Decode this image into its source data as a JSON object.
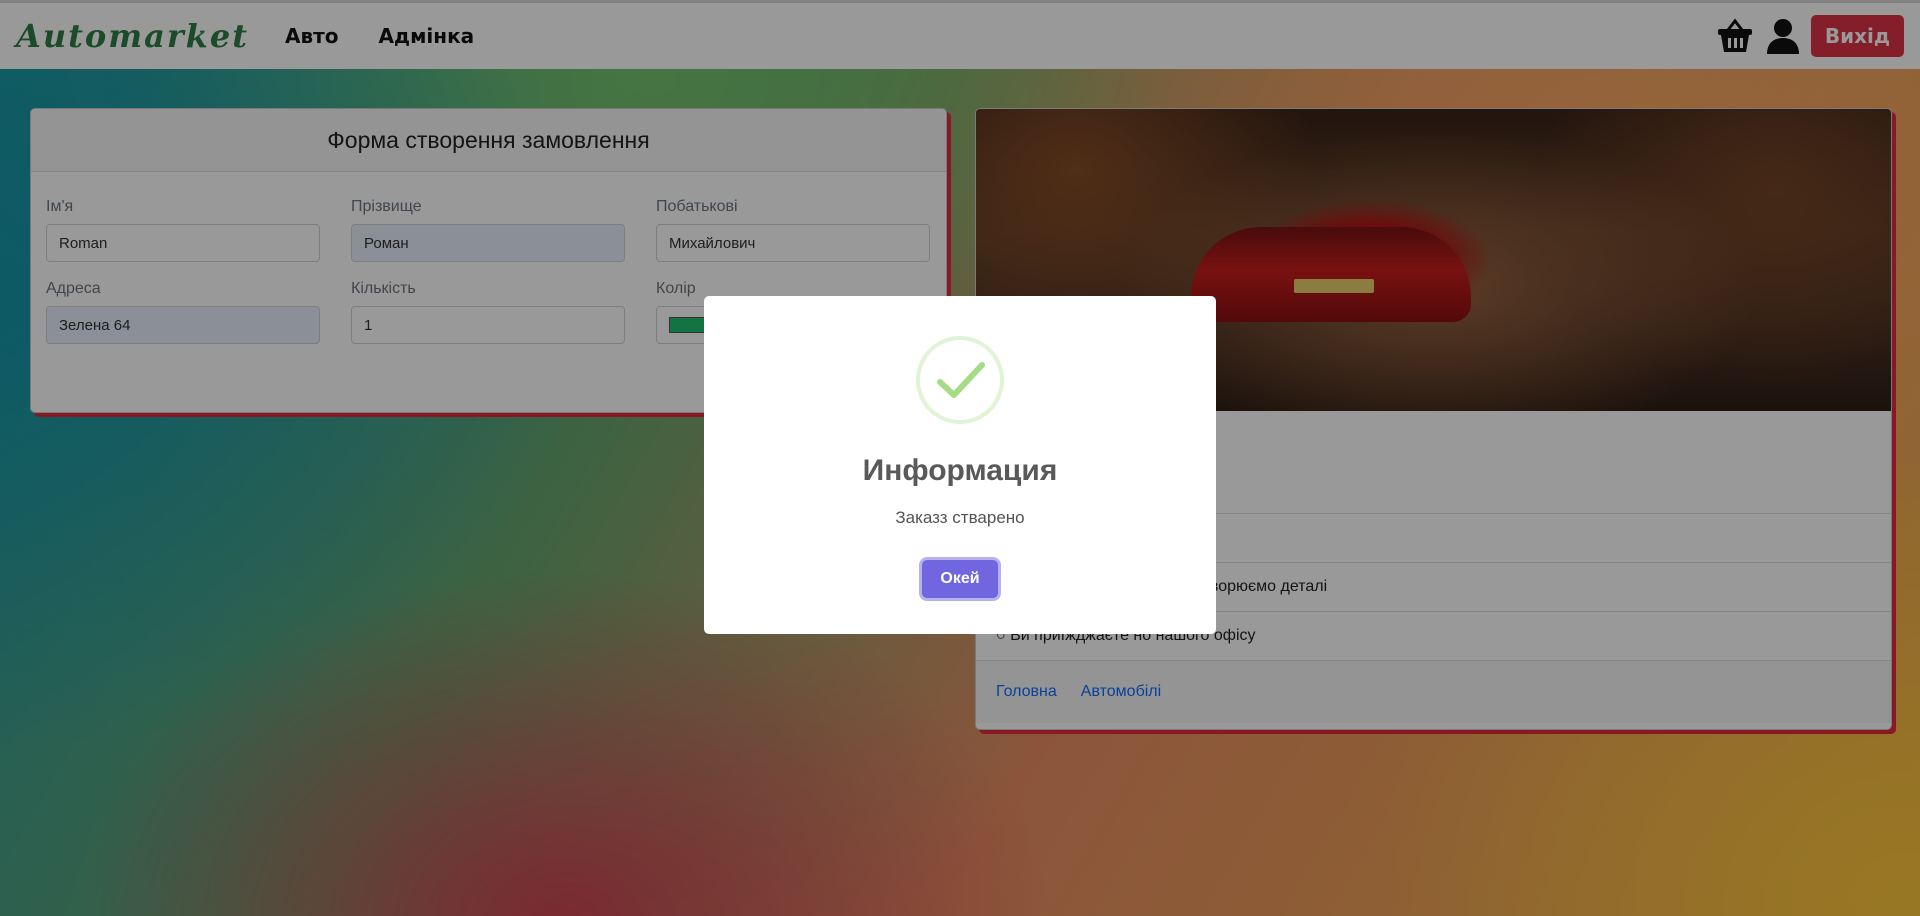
{
  "navbar": {
    "brand": "Automarket",
    "links": [
      "Авто",
      "Адмінка"
    ],
    "basket_icon": "basket-icon",
    "user_icon": "user-icon",
    "logout_label": "Вихід"
  },
  "form": {
    "title": "Форма створення замовлення",
    "fields": [
      {
        "label": "Ім'я",
        "value": "Roman"
      },
      {
        "label": "Прізвище",
        "value": "Роман"
      },
      {
        "label": "Побатькові",
        "value": "Михайлович"
      },
      {
        "label": "Адреса",
        "value": "Зелена 64"
      },
      {
        "label": "Кількість",
        "value": "1"
      },
      {
        "label": "Колір",
        "value": "#20c070"
      }
    ]
  },
  "car_card": {
    "items": [
      "",
      "оворюємо деталі",
      "○ Ви приїжджаєте но нашого офісу"
    ],
    "links": [
      "Головна",
      "Автомобілі"
    ]
  },
  "modal": {
    "icon": "success-check-icon",
    "title": "Информация",
    "text": "Заказз стварено",
    "ok_label": "Окей"
  },
  "colors": {
    "logout": "#dc3545",
    "ok_button": "#7066e0",
    "card_shadow": "#e2293c",
    "success": "#a5dc86"
  }
}
